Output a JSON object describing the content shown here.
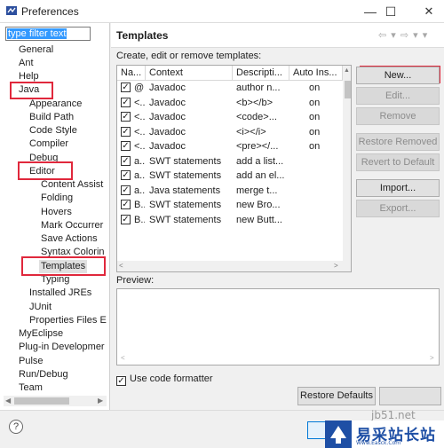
{
  "window": {
    "title": "Preferences",
    "min": "—",
    "max": "☐",
    "close": "✕"
  },
  "filter": {
    "value": "type filter text"
  },
  "tree": [
    {
      "label": "General"
    },
    {
      "label": "Ant"
    },
    {
      "label": "Help"
    },
    {
      "label": "Java"
    },
    {
      "label": "Appearance"
    },
    {
      "label": "Build Path"
    },
    {
      "label": "Code Style"
    },
    {
      "label": "Compiler"
    },
    {
      "label": "Debug"
    },
    {
      "label": "Editor"
    },
    {
      "label": "Content Assist"
    },
    {
      "label": "Folding"
    },
    {
      "label": "Hovers"
    },
    {
      "label": "Mark Occurrer"
    },
    {
      "label": "Save Actions"
    },
    {
      "label": "Syntax Colorin"
    },
    {
      "label": "Templates"
    },
    {
      "label": "Typing"
    },
    {
      "label": "Installed JREs"
    },
    {
      "label": "JUnit"
    },
    {
      "label": "Properties Files E"
    },
    {
      "label": "MyEclipse"
    },
    {
      "label": "Plug-in Developmer"
    },
    {
      "label": "Pulse"
    },
    {
      "label": "Run/Debug"
    },
    {
      "label": "Team"
    }
  ],
  "panel": {
    "title": "Templates",
    "nav": "⇦ ▾ ⇨ ▾ ▾",
    "description": "Create, edit or remove templates:"
  },
  "table": {
    "headers": [
      "Na...",
      "Context",
      "Descripti...",
      "Auto Ins..."
    ],
    "rows": [
      {
        "check": "✓",
        "name": "@",
        "context": "Javadoc",
        "desc": "author n...",
        "auto": "on"
      },
      {
        "check": "✓",
        "name": "<..",
        "context": "Javadoc",
        "desc": "<b></b>",
        "auto": "on"
      },
      {
        "check": "✓",
        "name": "<..",
        "context": "Javadoc",
        "desc": "<code>...",
        "auto": "on"
      },
      {
        "check": "✓",
        "name": "<..",
        "context": "Javadoc",
        "desc": "<i></i>",
        "auto": "on"
      },
      {
        "check": "✓",
        "name": "<..",
        "context": "Javadoc",
        "desc": "<pre></...",
        "auto": "on"
      },
      {
        "check": "✓",
        "name": "a..",
        "context": "SWT statements",
        "desc": "add a list...",
        "auto": ""
      },
      {
        "check": "✓",
        "name": "a..",
        "context": "SWT statements",
        "desc": "add an el...",
        "auto": ""
      },
      {
        "check": "✓",
        "name": "a..",
        "context": "Java statements",
        "desc": "merge t...",
        "auto": ""
      },
      {
        "check": "✓",
        "name": "B..",
        "context": "SWT statements",
        "desc": "new Bro...",
        "auto": ""
      },
      {
        "check": "✓",
        "name": "B..",
        "context": "SWT statements",
        "desc": "new Butt...",
        "auto": ""
      }
    ]
  },
  "buttons": {
    "new": "New...",
    "edit": "Edit...",
    "remove": "Remove",
    "restore_removed": "Restore Removed",
    "revert": "Revert to Default",
    "import": "Import...",
    "export": "Export..."
  },
  "preview": {
    "label": "Preview:"
  },
  "formatter": {
    "label": "Use code formatter",
    "check": "✓"
  },
  "footer": {
    "restore_defaults": "Restore Defaults",
    "help": "?"
  },
  "watermark": {
    "site": "jb51.net",
    "name": "易采站长站",
    "sub": "Www.Easck.Com"
  },
  "colors": {
    "highlight": "#e0283c",
    "selection": "#3399ff",
    "brand": "#1e4fa5"
  }
}
